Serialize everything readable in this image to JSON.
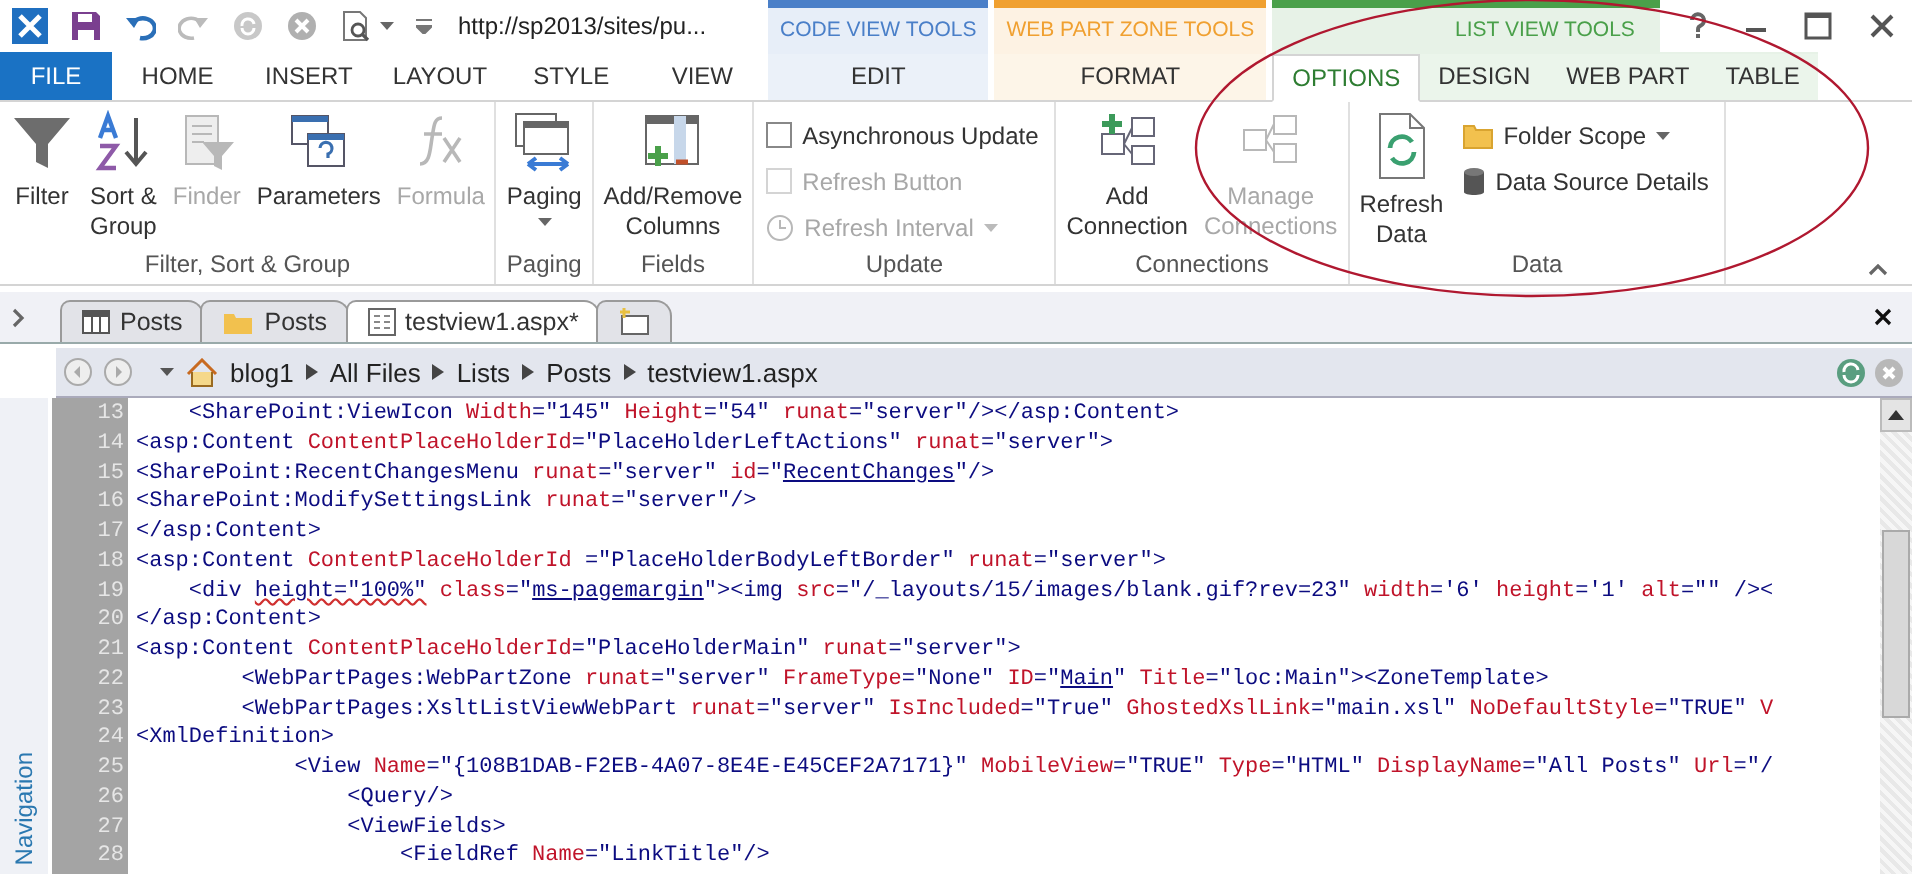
{
  "title_bar": {
    "url": "http://sp2013/sites/pu..."
  },
  "ribbon_tabs": [
    {
      "label": "FILE",
      "kind": "file",
      "selected": false
    },
    {
      "label": "HOME",
      "kind": "tab",
      "selected": false
    },
    {
      "label": "INSERT",
      "kind": "tab",
      "selected": false
    },
    {
      "label": "LAYOUT",
      "kind": "tab",
      "selected": false
    },
    {
      "label": "STYLE",
      "kind": "tab",
      "selected": false
    },
    {
      "label": "VIEW",
      "kind": "tab",
      "selected": false
    }
  ],
  "contextual_groups": [
    {
      "title": "CODE VIEW TOOLS",
      "color": "#4a7fc8",
      "tabs": [
        {
          "label": "EDIT",
          "selected": false
        }
      ]
    },
    {
      "title": "WEB PART ZONE TOOLS",
      "color": "#f0a030",
      "tabs": [
        {
          "label": "FORMAT",
          "selected": false
        }
      ]
    },
    {
      "title": "LIST VIEW TOOLS",
      "color": "#4aa04a",
      "tabs": [
        {
          "label": "OPTIONS",
          "selected": true
        },
        {
          "label": "DESIGN",
          "selected": false
        },
        {
          "label": "WEB PART",
          "selected": false
        },
        {
          "label": "TABLE",
          "selected": false
        }
      ]
    }
  ],
  "ribbon": {
    "groups": [
      {
        "label": "Filter, Sort & Group",
        "items": [
          {
            "kind": "large",
            "label": "Filter",
            "disabled": false,
            "dropdown": false
          },
          {
            "kind": "large",
            "label": "Sort &\nGroup",
            "disabled": false,
            "dropdown": false
          },
          {
            "kind": "large",
            "label": "Finder",
            "disabled": true,
            "dropdown": false
          },
          {
            "kind": "large",
            "label": "Parameters",
            "disabled": false,
            "dropdown": false
          },
          {
            "kind": "large",
            "label": "Formula",
            "disabled": true,
            "dropdown": false
          }
        ]
      },
      {
        "label": "Paging",
        "items": [
          {
            "kind": "large",
            "label": "Paging",
            "disabled": false,
            "dropdown": true
          }
        ]
      },
      {
        "label": "Fields",
        "items": [
          {
            "kind": "large",
            "label": "Add/Remove\nColumns",
            "disabled": false,
            "dropdown": false
          }
        ]
      },
      {
        "label": "Update",
        "items": [
          {
            "kind": "checkbox",
            "label": "Asynchronous Update",
            "checked": false,
            "disabled": false
          },
          {
            "kind": "checkbox",
            "label": "Refresh Button",
            "checked": false,
            "disabled": true
          },
          {
            "kind": "small",
            "label": "Refresh Interval",
            "disabled": true,
            "dropdown": true
          }
        ]
      },
      {
        "label": "Connections",
        "items": [
          {
            "kind": "large",
            "label": "Add\nConnection",
            "disabled": false,
            "dropdown": false
          },
          {
            "kind": "large",
            "label": "Manage\nConnections",
            "disabled": true,
            "dropdown": false
          }
        ]
      },
      {
        "label": "Data",
        "items": [
          {
            "kind": "large",
            "label": "Refresh\nData",
            "disabled": false,
            "dropdown": false
          },
          {
            "kind": "small",
            "label": "Folder Scope",
            "disabled": false,
            "dropdown": true
          },
          {
            "kind": "small",
            "label": "Data Source Details",
            "disabled": false,
            "dropdown": false
          }
        ]
      }
    ]
  },
  "document_tabs": [
    {
      "label": "Posts",
      "selected": false
    },
    {
      "label": "Posts",
      "selected": false
    },
    {
      "label": "testview1.aspx*",
      "selected": true
    }
  ],
  "breadcrumb": [
    "blog1",
    "All Files",
    "Lists",
    "Posts",
    "testview1.aspx"
  ],
  "sidebar": {
    "label": "Navigation"
  },
  "editor": {
    "lines": [
      {
        "number": "13",
        "tokens": [
          {
            "kind": "tag",
            "text": "    <SharePoint:ViewIcon "
          },
          {
            "kind": "attr",
            "text": "Width"
          },
          {
            "kind": "tag",
            "text": "=\"145\" "
          },
          {
            "kind": "attr",
            "text": "Height"
          },
          {
            "kind": "tag",
            "text": "=\"54\" "
          },
          {
            "kind": "attr",
            "text": "runat"
          },
          {
            "kind": "tag",
            "text": "=\"server\"/></asp:Content>"
          }
        ]
      },
      {
        "number": "14",
        "tokens": [
          {
            "kind": "tag",
            "text": "<asp:Content "
          },
          {
            "kind": "attr",
            "text": "ContentPlaceHolderId"
          },
          {
            "kind": "tag",
            "text": "=\"PlaceHolderLeftActions\" "
          },
          {
            "kind": "attr",
            "text": "runat"
          },
          {
            "kind": "tag",
            "text": "=\"server\">"
          }
        ]
      },
      {
        "number": "15",
        "tokens": [
          {
            "kind": "tag",
            "text": "<SharePoint:RecentChangesMenu "
          },
          {
            "kind": "attr",
            "text": "runat"
          },
          {
            "kind": "tag",
            "text": "=\"server\" "
          },
          {
            "kind": "attr",
            "text": "id"
          },
          {
            "kind": "tag",
            "text": "=\""
          },
          {
            "kind": "link",
            "text": "RecentChanges"
          },
          {
            "kind": "tag",
            "text": "\"/>"
          }
        ]
      },
      {
        "number": "16",
        "tokens": [
          {
            "kind": "tag",
            "text": "<SharePoint:ModifySettingsLink "
          },
          {
            "kind": "attr",
            "text": "runat"
          },
          {
            "kind": "tag",
            "text": "=\"server\"/>"
          }
        ]
      },
      {
        "number": "17",
        "tokens": [
          {
            "kind": "tag",
            "text": "</asp:Content>"
          }
        ]
      },
      {
        "number": "18",
        "tokens": [
          {
            "kind": "tag",
            "text": "<asp:Content "
          },
          {
            "kind": "attr",
            "text": "ContentPlaceHolderId"
          },
          {
            "kind": "tag",
            "text": " =\"PlaceHolderBodyLeftBorder\" "
          },
          {
            "kind": "attr",
            "text": "runat"
          },
          {
            "kind": "tag",
            "text": "=\"server\">"
          }
        ]
      },
      {
        "number": "19",
        "tokens": [
          {
            "kind": "tag",
            "text": "    <div "
          },
          {
            "kind": "misspelled",
            "text": "height=\"100%\""
          },
          {
            "kind": "attr",
            "text": " class"
          },
          {
            "kind": "tag",
            "text": "=\""
          },
          {
            "kind": "link",
            "text": "ms-pagemargin"
          },
          {
            "kind": "tag",
            "text": "\"><img "
          },
          {
            "kind": "attr",
            "text": "src"
          },
          {
            "kind": "tag",
            "text": "=\"/_layouts/15/images/blank.gif?rev=23\" "
          },
          {
            "kind": "attr",
            "text": "width"
          },
          {
            "kind": "tag",
            "text": "='6' "
          },
          {
            "kind": "attr",
            "text": "height"
          },
          {
            "kind": "tag",
            "text": "='1' "
          },
          {
            "kind": "attr",
            "text": "alt"
          },
          {
            "kind": "tag",
            "text": "=\"\" /><"
          }
        ]
      },
      {
        "number": "20",
        "tokens": [
          {
            "kind": "tag",
            "text": "</asp:Content>"
          }
        ]
      },
      {
        "number": "21",
        "tokens": [
          {
            "kind": "tag",
            "text": "<asp:Content "
          },
          {
            "kind": "attr",
            "text": "ContentPlaceHolderId"
          },
          {
            "kind": "tag",
            "text": "=\"PlaceHolderMain\" "
          },
          {
            "kind": "attr",
            "text": "runat"
          },
          {
            "kind": "tag",
            "text": "=\"server\">"
          }
        ]
      },
      {
        "number": "22",
        "tokens": [
          {
            "kind": "tag",
            "text": "        <WebPartPages:WebPartZone "
          },
          {
            "kind": "attr",
            "text": "runat"
          },
          {
            "kind": "tag",
            "text": "=\"server\" "
          },
          {
            "kind": "attr",
            "text": "FrameType"
          },
          {
            "kind": "tag",
            "text": "=\"None\" "
          },
          {
            "kind": "attr",
            "text": "ID"
          },
          {
            "kind": "tag",
            "text": "=\""
          },
          {
            "kind": "link",
            "text": "Main"
          },
          {
            "kind": "tag",
            "text": "\" "
          },
          {
            "kind": "attr",
            "text": "Title"
          },
          {
            "kind": "tag",
            "text": "=\"loc:Main\"><ZoneTemplate>"
          }
        ]
      },
      {
        "number": "23",
        "tokens": [
          {
            "kind": "tag",
            "text": "        <WebPartPages:XsltListViewWebPart "
          },
          {
            "kind": "attr",
            "text": "runat"
          },
          {
            "kind": "tag",
            "text": "=\"server\" "
          },
          {
            "kind": "attr",
            "text": "IsIncluded"
          },
          {
            "kind": "tag",
            "text": "=\"True\" "
          },
          {
            "kind": "attr",
            "text": "GhostedXslLink"
          },
          {
            "kind": "tag",
            "text": "=\"main.xsl\" "
          },
          {
            "kind": "attr",
            "text": "NoDefaultStyle"
          },
          {
            "kind": "tag",
            "text": "=\"TRUE\" "
          },
          {
            "kind": "attr",
            "text": "V"
          }
        ]
      },
      {
        "number": "24",
        "tokens": [
          {
            "kind": "tag",
            "text": "<XmlDefinition>"
          }
        ]
      },
      {
        "number": "25",
        "tokens": [
          {
            "kind": "tag",
            "text": "            <View "
          },
          {
            "kind": "attr",
            "text": "Name"
          },
          {
            "kind": "tag",
            "text": "=\"{108B1DAB-F2EB-4A07-8E4E-E45CEF2A7171}\" "
          },
          {
            "kind": "attr",
            "text": "MobileView"
          },
          {
            "kind": "tag",
            "text": "=\"TRUE\" "
          },
          {
            "kind": "attr",
            "text": "Type"
          },
          {
            "kind": "tag",
            "text": "=\"HTML\" "
          },
          {
            "kind": "attr",
            "text": "DisplayName"
          },
          {
            "kind": "tag",
            "text": "=\"All Posts\" "
          },
          {
            "kind": "attr",
            "text": "Url"
          },
          {
            "kind": "tag",
            "text": "=\"/"
          }
        ]
      },
      {
        "number": "26",
        "tokens": [
          {
            "kind": "tag",
            "text": "                <Query/>"
          }
        ]
      },
      {
        "number": "27",
        "tokens": [
          {
            "kind": "tag",
            "text": "                <ViewFields>"
          }
        ]
      },
      {
        "number": "28",
        "tokens": [
          {
            "kind": "tag",
            "text": "                    <FieldRef "
          },
          {
            "kind": "attr",
            "text": "Name"
          },
          {
            "kind": "tag",
            "text": "=\"LinkTitle\"/>"
          }
        ]
      }
    ]
  }
}
